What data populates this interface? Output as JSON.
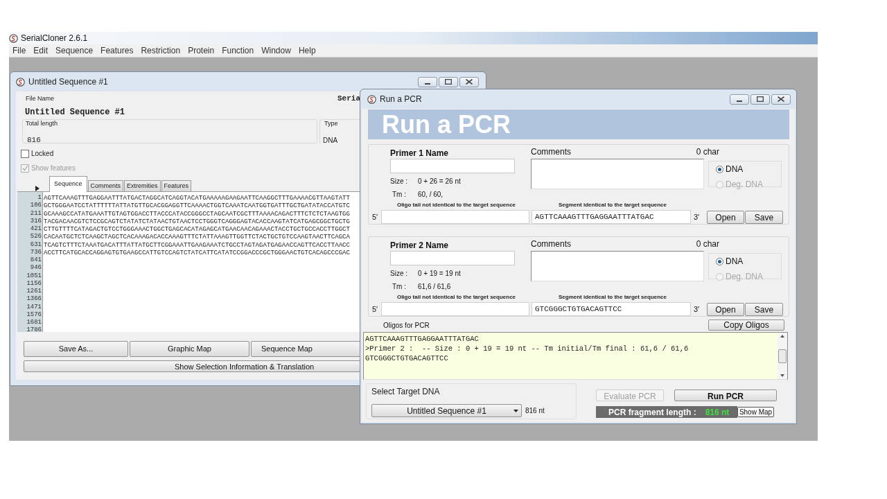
{
  "app": {
    "title": "SerialCloner 2.6.1",
    "menu": [
      "File",
      "Edit",
      "Sequence",
      "Features",
      "Restriction",
      "Protein",
      "Function",
      "Window",
      "Help"
    ]
  },
  "sequence_window": {
    "title": "Untitled Sequence #1",
    "header_cut": "Seria",
    "file_name_label": "File Name",
    "file_name": "Untitled Sequence #1",
    "total_length_label": "Total length",
    "total_length": "816",
    "type_label": "Type",
    "type": "DNA",
    "locked": {
      "label": "Locked",
      "checked": false
    },
    "show_features": {
      "label": "Show features",
      "checked": true,
      "disabled": true
    },
    "tabs": [
      {
        "label": "Sequence",
        "selected": true
      },
      {
        "label": "Comments",
        "selected": false
      },
      {
        "label": "Extremities",
        "selected": false
      },
      {
        "label": "Features",
        "selected": false
      }
    ],
    "rows": [
      {
        "number": "1",
        "sequence": "AGTTCAAAGTTTGAGGAATTTATGACTAGGCATCAGGTACATGAAAAAGAAGAATTCAAGGCTTTGAAAACGTTAAGTATT"
      },
      {
        "number": "106",
        "sequence": "GCTGGGAATCCTATTTTTTATTATGTTGCACGGAGGTTCAAAACTGGTCAAATCAATGGTGATTTGCTGATATACCATGTC"
      },
      {
        "number": "211",
        "sequence": "GCAAAGCCATATGAAATTGTAGTGGACCTTACCCATACCGGGCCTAGCAATCGCTTTAAAACAGACTTTCTCTCTAAGTGG"
      },
      {
        "number": "316",
        "sequence": "TACGACAACGTCTCCGCAGTCTATATCTATAACTGTAACTCCTGGGTCAGGGAGTACACCAAGTATCATGAGCGGCTGCTG"
      },
      {
        "number": "421",
        "sequence": "CTTGTTTTCATAGACTGTCCTGGGAAACTGGCTGAGCACATAGAGCATGAACAACAGAAACTACCTGCTGCCACCTTGGCT"
      },
      {
        "number": "526",
        "sequence": "CACAATGCTCTCAAGCTAGCTCACAAAGACACCAAAGTTTCTATTAAAGTTGGTTCTACTGCTGTCCAAGTAACTTCAGCA"
      },
      {
        "number": "631",
        "sequence": "TCAGTCTTTCTAAATGACATTTATTATGCTTCGGAAATTGAAGAAATCTGCCTAGTAGATGAGAACCAGTTCACCTTAACC"
      },
      {
        "number": "736",
        "sequence": "ACCTTCATGCACCAGGAGTGTGAAGCCATTGTCCAGTCTATCATTCATATCCGGACCCGCTGGGAACTGTCACAGCCCGAC"
      },
      {
        "number": "841"
      },
      {
        "number": "946"
      },
      {
        "number": "1051"
      },
      {
        "number": "1156"
      },
      {
        "number": "1261"
      },
      {
        "number": "1366"
      },
      {
        "number": "1471"
      },
      {
        "number": "1576"
      },
      {
        "number": "1681"
      },
      {
        "number": "1786"
      }
    ],
    "buttons": [
      "Save As...",
      "Graphic Map",
      "Sequence Map"
    ],
    "wide_button": "Show Selection Information & Translation"
  },
  "pcr_window": {
    "title": "Run a PCR",
    "banner": "Run a PCR",
    "primers": [
      {
        "name_label": "Primer 1 Name",
        "comments_label": "Comments",
        "char_count": "0 char",
        "size_label": "Size :",
        "size": "0 + 26 = 26 nt",
        "tm_label": "Tm :",
        "tm": "60, / 60,",
        "types": [
          {
            "label": "DNA",
            "selected": true,
            "disabled": false
          },
          {
            "label": "Deg. DNA",
            "selected": false,
            "disabled": true
          }
        ],
        "tail_label": "Oligo tail not identical to the target sequence",
        "segment_label": "Segment identical to the target sequence",
        "end5": "5'",
        "segment": "AGTTCAAAGTTTGAGGAATTTATGAC",
        "end3": "3'",
        "buttons": [
          "Open",
          "Save"
        ]
      },
      {
        "name_label": "Primer 2 Name",
        "comments_label": "Comments",
        "char_count": "0 char",
        "size_label": "Size :",
        "size": "0 + 19 = 19 nt",
        "tm_label": "Tm :",
        "tm": "61,6 / 61,6",
        "types": [
          {
            "label": "DNA",
            "selected": true,
            "disabled": false
          },
          {
            "label": "Deg. DNA",
            "selected": false,
            "disabled": true
          }
        ],
        "tail_label": "Oligo tail not identical to the target sequence",
        "segment_label": "Segment identical to the target sequence",
        "end5": "5'",
        "segment": "GTCGGGCTGTGACAGTTCC",
        "end3": "3'",
        "buttons": [
          "Open",
          "Save"
        ]
      }
    ],
    "oligos_label": "Oligos for PCR",
    "copy_button": "Copy Oligos",
    "oligos_text": [
      "AGTTCAAAGTTTGAGGAATTTATGAC",
      ">Primer 2 :  -- Size : 0 + 19 = 19 nt -- Tm initial/Tm final : 61,6 / 61,6",
      "GTCGGGCTGTGACAGTTCC"
    ],
    "target": {
      "label": "Select Target DNA",
      "selected": "Untitled Sequence #1",
      "length": "816 nt"
    },
    "evaluate": {
      "label": "Evaluate PCR",
      "disabled": true
    },
    "run": {
      "label": "Run PCR",
      "disabled": false
    },
    "fragment": {
      "label": "PCR fragment length :",
      "value": "816 nt"
    },
    "show_map": "Show Map"
  }
}
